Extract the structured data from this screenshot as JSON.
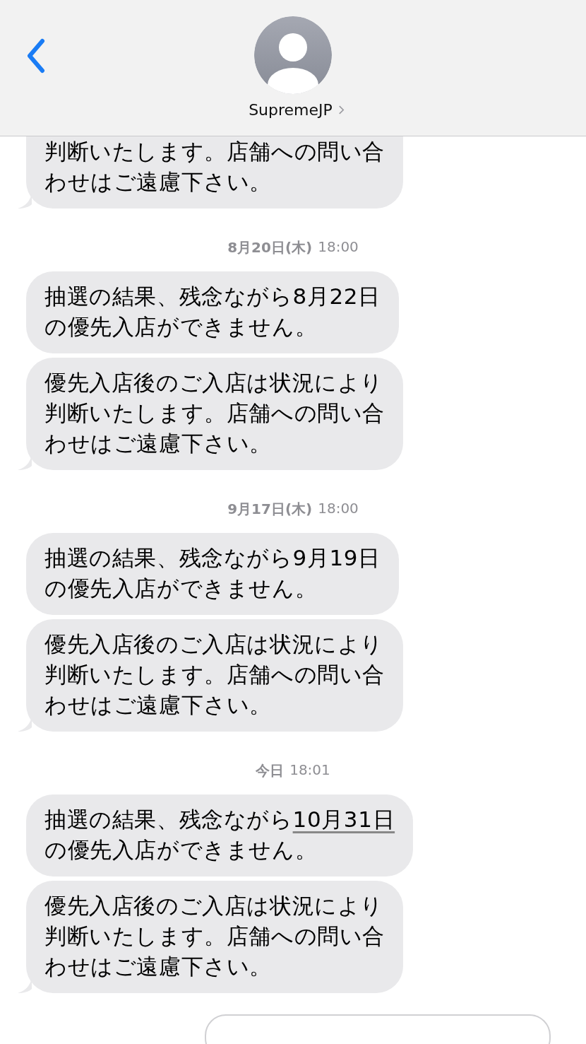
{
  "header": {
    "contact": {
      "name": "SupremeJP"
    }
  },
  "conversation": [
    {
      "kind": "messages",
      "cut_off": true,
      "messages": [
        {
          "lines": [
            "判断いたします。店舗への問い合",
            "わせはご遠慮下さい。"
          ]
        }
      ]
    },
    {
      "kind": "timestamp",
      "date": "8月20日(木)",
      "time": "18:00"
    },
    {
      "kind": "messages",
      "cut_off": false,
      "messages": [
        {
          "lines": [
            "抽選の結果、残念ながら8月22日",
            "の優先入店ができません。"
          ]
        },
        {
          "lines": [
            "優先入店後のご入店は状況により",
            "判断いたします。店舗への問い合",
            "わせはご遠慮下さい。"
          ]
        }
      ]
    },
    {
      "kind": "timestamp",
      "date": "9月17日(木)",
      "time": "18:00"
    },
    {
      "kind": "messages",
      "cut_off": false,
      "messages": [
        {
          "lines": [
            "抽選の結果、残念ながら9月19日",
            "の優先入店ができません。"
          ]
        },
        {
          "lines": [
            "優先入店後のご入店は状況により",
            "判断いたします。店舗への問い合",
            "わせはご遠慮下さい。"
          ]
        }
      ]
    },
    {
      "kind": "timestamp",
      "date": "今日",
      "time": "18:01"
    },
    {
      "kind": "messages",
      "cut_off": false,
      "messages": [
        {
          "lines": [
            {
              "parts": [
                {
                  "text": "抽選の結果、残念ながら"
                },
                {
                  "text": "10月31日",
                  "link": true
                }
              ]
            },
            "の優先入店ができません。"
          ]
        },
        {
          "lines": [
            "優先入店後のご入店は状況により",
            "判断いたします。店舗への問い合",
            "わせはご遠慮下さい。"
          ]
        }
      ]
    }
  ]
}
